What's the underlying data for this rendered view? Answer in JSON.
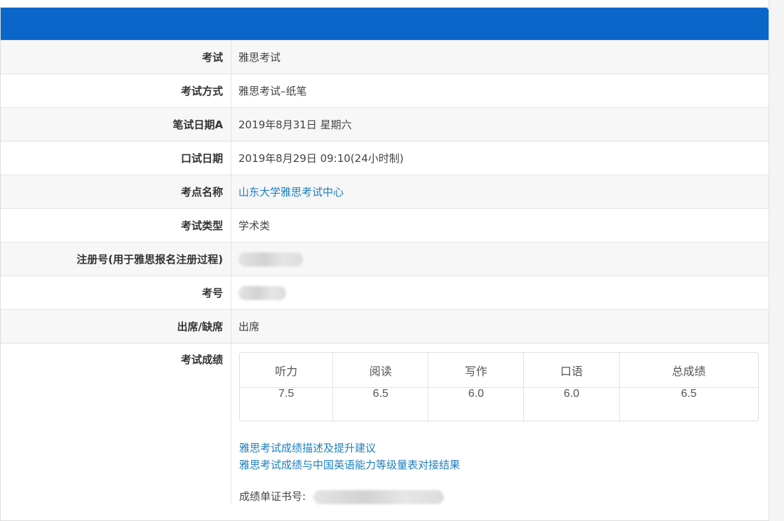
{
  "rows": [
    {
      "label": "考试",
      "value": "雅思考试",
      "type": "text"
    },
    {
      "label": "考试方式",
      "value": "雅思考试–纸笔",
      "type": "text"
    },
    {
      "label": "笔试日期A",
      "value": "2019年8月31日 星期六",
      "type": "text"
    },
    {
      "label": "口试日期",
      "value": "2019年8月29日 09:10(24小时制)",
      "type": "text"
    },
    {
      "label": "考点名称",
      "value": "山东大学雅思考试中心",
      "type": "link"
    },
    {
      "label": "考试类型",
      "value": "学术类",
      "type": "text"
    },
    {
      "label": "注册号(用于雅思报名注册过程)",
      "value": "",
      "type": "blur"
    },
    {
      "label": "考号",
      "value": "",
      "type": "blur"
    },
    {
      "label": "出席/缺席",
      "value": "出席",
      "type": "text"
    }
  ],
  "scores": {
    "label": "考试成绩",
    "headers": [
      "听力",
      "阅读",
      "写作",
      "口语",
      "总成绩"
    ],
    "values": [
      "7.5",
      "6.5",
      "6.0",
      "6.0",
      "6.5"
    ]
  },
  "links": [
    "雅思考试成绩描述及提升建议",
    "雅思考试成绩与中国英语能力等级量表对接结果"
  ],
  "certificate_label": "成绩单证书号:",
  "colors": {
    "header": "#0a66c9",
    "link": "#1d7fbe"
  }
}
